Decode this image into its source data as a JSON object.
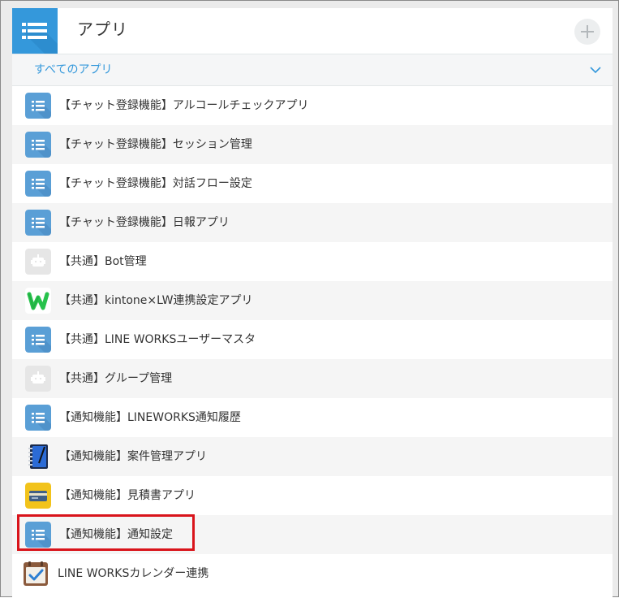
{
  "header": {
    "title": "アプリ",
    "app_icon": "list-icon",
    "add_icon": "plus-icon"
  },
  "filter": {
    "label": "すべてのアプリ",
    "icon": "chevron-down-icon"
  },
  "apps": [
    {
      "label": "【チャット登録機能】アルコールチェックアプリ",
      "icon": "list-icon"
    },
    {
      "label": "【チャット登録機能】セッション管理",
      "icon": "list-icon"
    },
    {
      "label": "【チャット登録機能】対話フロー設定",
      "icon": "list-icon"
    },
    {
      "label": "【チャット登録機能】日報アプリ",
      "icon": "list-icon"
    },
    {
      "label": "【共通】Bot管理",
      "icon": "robot-icon"
    },
    {
      "label": "【共通】kintone×LW連携設定アプリ",
      "icon": "w-logo-icon"
    },
    {
      "label": "【共通】LINE WORKSユーザーマスタ",
      "icon": "list-icon"
    },
    {
      "label": "【共通】グループ管理",
      "icon": "robot-icon"
    },
    {
      "label": "【通知機能】LINEWORKS通知履歴",
      "icon": "list-icon"
    },
    {
      "label": "【通知機能】案件管理アプリ",
      "icon": "notebook-icon"
    },
    {
      "label": "【通知機能】見積書アプリ",
      "icon": "card-icon"
    },
    {
      "label": "【通知機能】通知設定",
      "icon": "list-icon",
      "highlighted": true
    },
    {
      "label": "LINE WORKSカレンダー連携",
      "icon": "calendar-check-icon"
    }
  ],
  "colors": {
    "accent": "#3498db",
    "list_icon_bg": "#5a9fd6",
    "highlight": "#d9141b"
  }
}
